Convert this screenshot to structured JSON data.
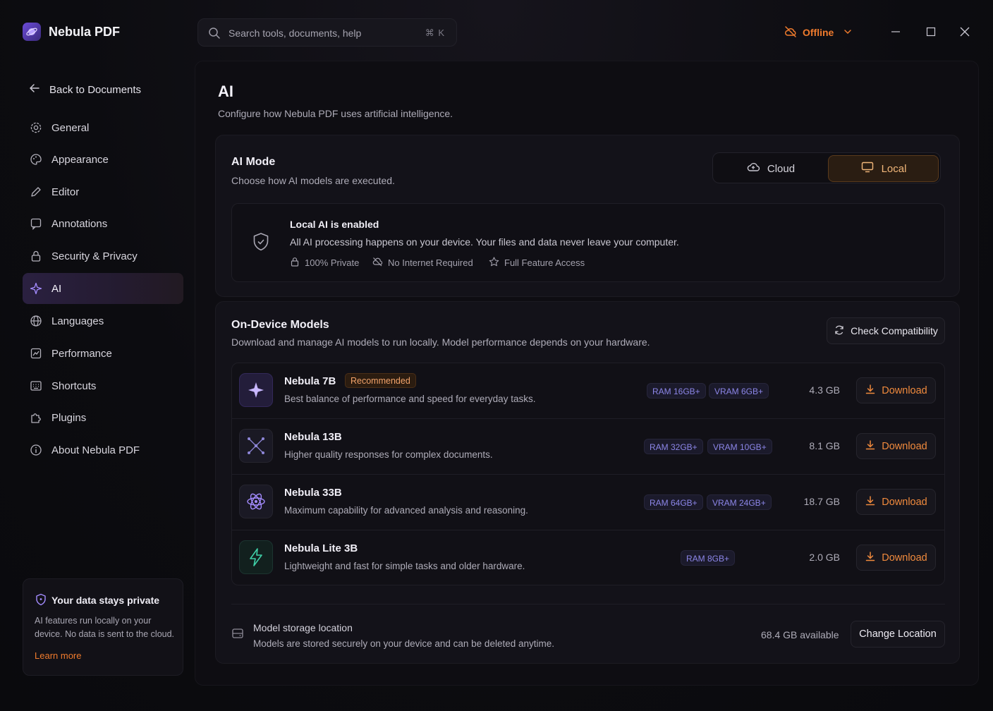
{
  "app": {
    "title": "Nebula PDF",
    "search_placeholder": "Search tools, documents, help",
    "search_shortcut": "⌘ K",
    "status_label": "Offline",
    "accent_color": "#f07b2d"
  },
  "sidebar": {
    "back_label": "Back to Documents",
    "items": [
      {
        "label": "General",
        "icon": "gear-icon"
      },
      {
        "label": "Appearance",
        "icon": "palette-icon"
      },
      {
        "label": "Editor",
        "icon": "pencil-icon"
      },
      {
        "label": "Annotations",
        "icon": "comment-icon"
      },
      {
        "label": "Security & Privacy",
        "icon": "lock-icon"
      },
      {
        "label": "AI",
        "icon": "sparkle-icon",
        "active": true
      },
      {
        "label": "Languages",
        "icon": "globe-icon"
      },
      {
        "label": "Performance",
        "icon": "gauge-icon"
      },
      {
        "label": "Shortcuts",
        "icon": "keyboard-icon"
      },
      {
        "label": "Plugins",
        "icon": "puzzle-icon"
      },
      {
        "label": "About Nebula PDF",
        "icon": "info-icon"
      }
    ],
    "privacy_card": {
      "title": "Your data stays private",
      "body": "AI features run locally on your device. No data is sent to the cloud.",
      "link": "Learn more"
    }
  },
  "main": {
    "title": "AI",
    "subtitle": "Configure how Nebula PDF uses artificial intelligence.",
    "ai_mode": {
      "title": "AI Mode",
      "subtitle": "Choose how AI models are executed.",
      "options": [
        "Cloud",
        "Local"
      ],
      "selected": "Local",
      "local_box": {
        "title": "Local AI is enabled",
        "description": "All AI processing happens on your device. Your files and data never leave your computer.",
        "features": [
          "100% Private",
          "No Internet Required",
          "Full Feature Access"
        ]
      }
    },
    "models": {
      "title": "On-Device Models",
      "subtitle": "Download and manage AI models to run locally. Model performance depends on your hardware.",
      "check_label": "Check Compatibility",
      "download_label": "Download",
      "list": [
        {
          "name": "Nebula 7B",
          "badge": "Recommended",
          "description": "Best balance of performance and speed for everyday tasks.",
          "ram": "RAM 16GB+",
          "vram": "VRAM 6GB+",
          "size": "4.3 GB",
          "icon": "sparkle-icon"
        },
        {
          "name": "Nebula 13B",
          "badge": "",
          "description": "Higher quality responses for complex documents.",
          "ram": "RAM 32GB+",
          "vram": "VRAM 10GB+",
          "size": "8.1 GB",
          "icon": "network-icon"
        },
        {
          "name": "Nebula 33B",
          "badge": "",
          "description": "Maximum capability for advanced analysis and reasoning.",
          "ram": "RAM 64GB+",
          "vram": "VRAM 24GB+",
          "size": "18.7 GB",
          "icon": "atom-icon"
        },
        {
          "name": "Nebula Lite 3B",
          "badge": "",
          "description": "Lightweight and fast for simple tasks and older hardware.",
          "ram": "RAM 8GB+",
          "vram": "",
          "size": "2.0 GB",
          "icon": "bolt-icon"
        }
      ]
    },
    "storage": {
      "title": "Model storage location",
      "subtitle": "Models are stored securely on your device and can be deleted anytime.",
      "available": "68.4 GB available",
      "change_label": "Change Location"
    }
  }
}
